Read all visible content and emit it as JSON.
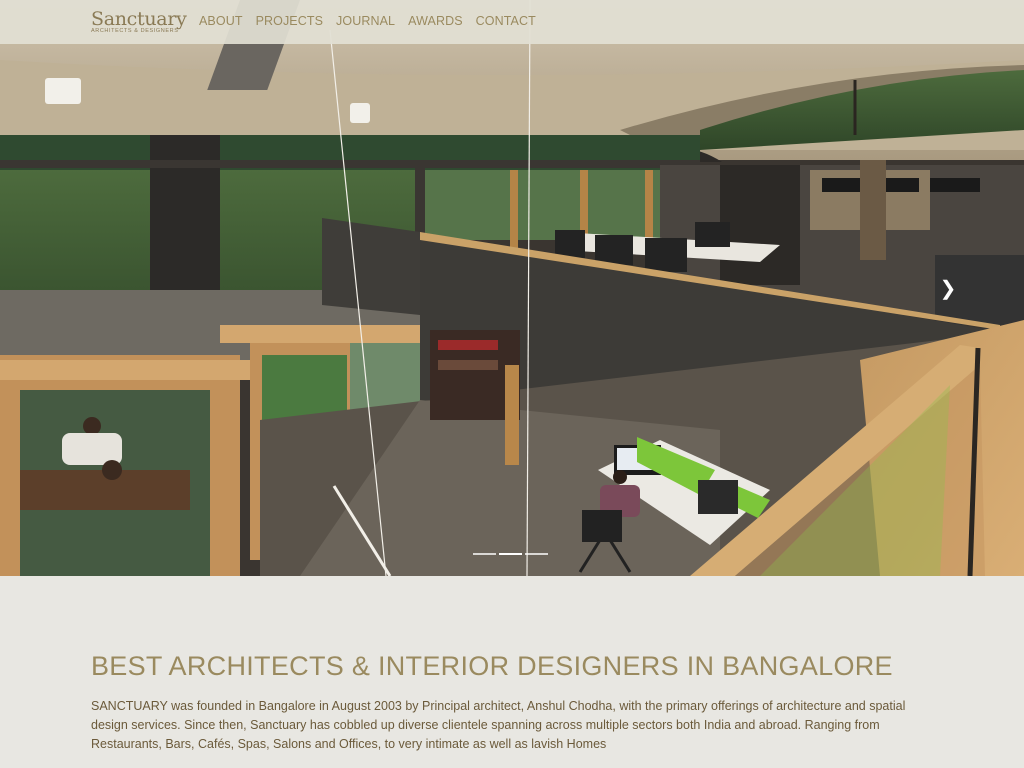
{
  "header": {
    "logo_main": "Sanctuary",
    "logo_sub": "ARCHITECTS & DESIGNERS",
    "nav": [
      "ABOUT",
      "PROJECTS",
      "JOURNAL",
      "AWARDS",
      "CONTACT"
    ]
  },
  "hero": {
    "image": "office-interior-photo",
    "next_icon": "chevron-right-icon",
    "slides_total": 3,
    "slides_active": 1
  },
  "intro": {
    "title": "BEST ARCHITECTS & INTERIOR DESIGNERS IN BANGALORE",
    "paragraph": "SANCTUARY was founded in Bangalore in August 2003 by Principal architect, Anshul Chodha, with the primary offerings of architecture and spatial design services. Since then, Sanctuary has cobbled up diverse clientele spanning across multiple sectors both India and abroad. Ranging from Restaurants, Bars, Cafés, Spas, Salons and Offices, to very intimate as well as lavish Homes"
  },
  "colors": {
    "accent": "#9a8a5f",
    "text": "#6b5a3a",
    "background": "#e8e7e2"
  }
}
